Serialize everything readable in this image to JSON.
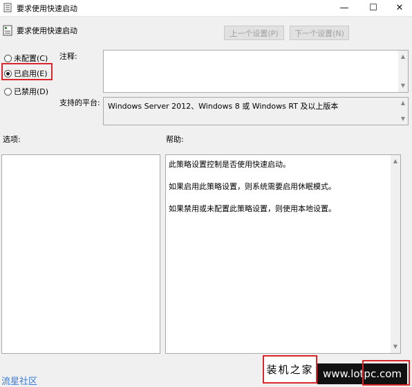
{
  "window": {
    "title": "要求使用快速启动",
    "minimize_glyph": "—",
    "maximize_glyph": "☐",
    "close_glyph": "✕"
  },
  "header": {
    "title": "要求使用快速启动",
    "prev_button": "上一个设置(P)",
    "next_button": "下一个设置(N)"
  },
  "state": {
    "options": [
      {
        "label": "未配置(C)",
        "checked": false
      },
      {
        "label": "已启用(E)",
        "checked": true
      },
      {
        "label": "已禁用(D)",
        "checked": false
      }
    ]
  },
  "comment": {
    "label": "注释:",
    "value": ""
  },
  "supported": {
    "label": "支持的平台:",
    "value": "Windows Server 2012、Windows 8 或 Windows RT 及以上版本"
  },
  "options_panel": {
    "label": "选项:"
  },
  "help_panel": {
    "label": "帮助:",
    "paragraphs": [
      "此策略设置控制是否使用快速启动。",
      "如果启用此策略设置，则系统需要启用休眠模式。",
      "如果禁用或未配置此策略设置，则使用本地设置。"
    ]
  },
  "watermarks": {
    "left": "流星社区",
    "center": "装机之家",
    "right": "www.lotpc.com"
  },
  "colors": {
    "highlight": "#d9262b",
    "watermark_blue": "#3a7bd5"
  },
  "icons": {
    "title": "policy-icon",
    "header": "policy-icon"
  }
}
